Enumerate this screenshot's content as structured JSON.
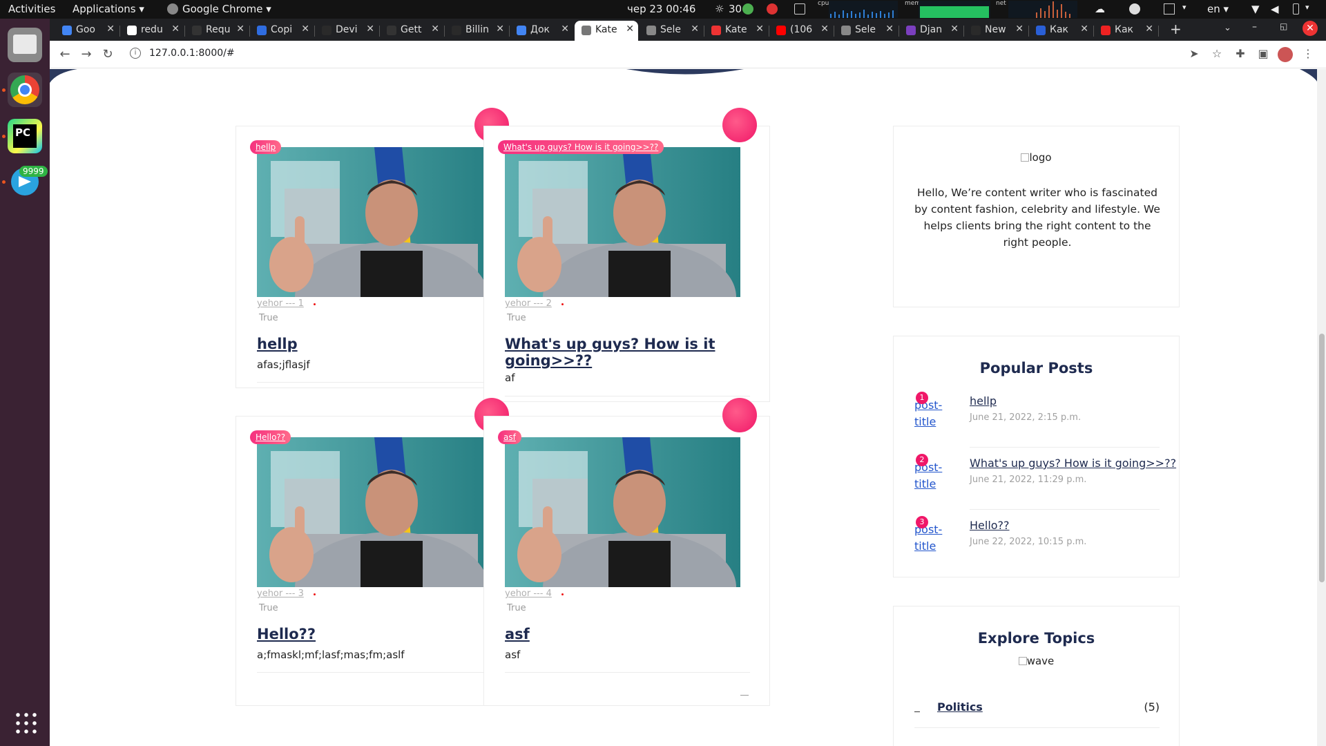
{
  "system": {
    "activities": "Activities",
    "applications": "Applications",
    "app_name": "Google Chrome",
    "datetime": "чер 23  00:46",
    "temperature": "30",
    "cpu_label": "cpu",
    "mem_label": "mem",
    "net_label": "net",
    "language": "en",
    "telegram_badge": "9999"
  },
  "tabs": [
    {
      "label": "Goo",
      "favicon_color": "#4285f4"
    },
    {
      "label": "redu",
      "favicon_color": "#ffffff"
    },
    {
      "label": "Requ",
      "favicon_color": "#333333"
    },
    {
      "label": "Copi",
      "favicon_color": "#2f6de1"
    },
    {
      "label": "Devi",
      "favicon_color": "#2a2a2a"
    },
    {
      "label": "Gett",
      "favicon_color": "#333333"
    },
    {
      "label": "Billin",
      "favicon_color": "#2a2a2a"
    },
    {
      "label": "Док",
      "favicon_color": "#4285f4"
    },
    {
      "label": "Kate",
      "favicon_color": "#777777",
      "active": true
    },
    {
      "label": "Sele",
      "favicon_color": "#888888"
    },
    {
      "label": "Kate",
      "favicon_color": "#e33"
    },
    {
      "label": "(106",
      "favicon_color": "#ff0000"
    },
    {
      "label": "Sele",
      "favicon_color": "#888888"
    },
    {
      "label": "Djan",
      "favicon_color": "#7b3fbf"
    },
    {
      "label": "New",
      "favicon_color": "#2a2a2a"
    },
    {
      "label": "Как",
      "favicon_color": "#2a5fd6"
    },
    {
      "label": "Как",
      "favicon_color": "#e22"
    }
  ],
  "address_bar": {
    "url": "127.0.0.1:8000/#"
  },
  "posts": [
    {
      "category": "hellp",
      "author": "yehor --- 1",
      "flag": "True",
      "title": "hellp",
      "body": "afas;jflasjf"
    },
    {
      "category": "What's up guys? How is it going>>??",
      "author": "yehor --- 2",
      "flag": "True",
      "title": "What's up guys? How is it going>>??",
      "body": "af"
    },
    {
      "category": "Hello??",
      "author": "yehor --- 3",
      "flag": "True",
      "title": "Hello??",
      "body": "a;fmaskl;mf;lasf;mas;fm;aslf"
    },
    {
      "category": "asf",
      "author": "yehor --- 4",
      "flag": "True",
      "title": "asf",
      "body": "asf"
    }
  ],
  "about": {
    "logo_alt": "logo",
    "text": "Hello, We’re content writer who is fascinated by content fashion, celebrity and lifestyle. We helps clients bring the right content to the right people."
  },
  "popular": {
    "heading": "Popular Posts",
    "thumb_alt": "post-title",
    "items": [
      {
        "rank": "1",
        "title": "hellp",
        "date": "June 21, 2022, 2:15 p.m."
      },
      {
        "rank": "2",
        "title": "What's up guys? How is it going>>??",
        "date": "June 21, 2022, 11:29 p.m."
      },
      {
        "rank": "3",
        "title": "Hello??",
        "date": "June 22, 2022, 10:15 p.m."
      }
    ]
  },
  "topics": {
    "heading": "Explore Topics",
    "wave_alt": "wave",
    "items": [
      {
        "name": "Politics",
        "count": "(5)"
      }
    ]
  },
  "colors": {
    "accent_pink": "#f01768",
    "navy": "#1e2a4f",
    "wave": "#2c3a5e"
  }
}
